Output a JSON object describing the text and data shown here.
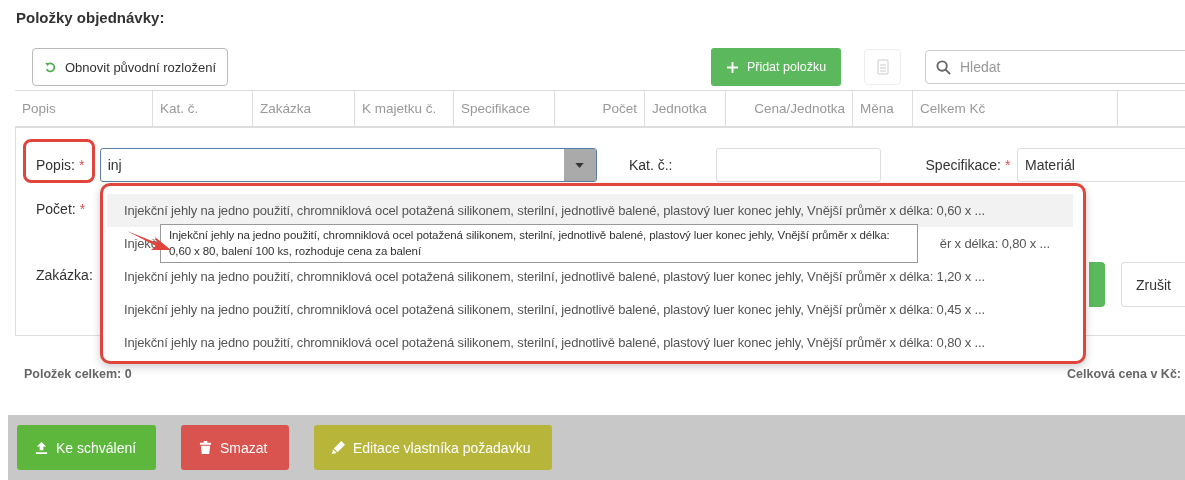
{
  "title": "Položky objednávky:",
  "toolbar": {
    "reset_button": "Obnovit původní rozložení",
    "add_button": "Přidat položku",
    "search": {
      "placeholder": "Hledat"
    }
  },
  "table": {
    "columns": [
      "Popis",
      "Kat. č.",
      "Zakázka",
      "K majetku č.",
      "Specifikace",
      "Počet",
      "Jednotka",
      "Cena/Jednotka",
      "Měna",
      "Celkem Kč"
    ]
  },
  "form": {
    "popis": {
      "label": "Popis:",
      "mark": "*",
      "value": "inj"
    },
    "kat": {
      "label": "Kat. č.:"
    },
    "specifikace": {
      "label": "Specifikace:",
      "mark": "*",
      "value": "Materiál"
    },
    "pocet": {
      "label": "Počet:",
      "mark": "*"
    },
    "zakazka": {
      "label": "Zakázka:"
    },
    "cancel_button": "Zrušit"
  },
  "dropdown": {
    "options": [
      {
        "text": "Injekční jehly na jedno použití, chromniklová ocel potažená silikonem, sterilní, jednotlivě balené, plastový luer konec jehly, Vnější průměr x délka: 0,60 x ...",
        "selected": true
      },
      {
        "text_start": "Injekč",
        "text_end": "ěr x délka: 0,80 x ...",
        "selected": false
      },
      {
        "text": "Injekční jehly na jedno použití, chromniklová ocel potažená silikonem, sterilní, jednotlivě balené, plastový luer konec jehly, Vnější průměr x délka: 1,20 x ...",
        "selected": false
      },
      {
        "text": "Injekční jehly na jedno použití, chromniklová ocel potažená silikonem, sterilní, jednotlivě balené, plastový luer konec jehly, Vnější průměr x délka: 0,45 x ...",
        "selected": false
      },
      {
        "text": "Injekční jehly na jedno použití, chromniklová ocel potažená silikonem, sterilní, jednotlivě balené, plastový luer konec jehly, Vnější průměr x délka: 0,80 x ...",
        "selected": false
      }
    ],
    "tooltip": "Injekční jehly na jedno použití, chromniklová ocel potažená silikonem, sterilní, jednotlivě balené, plastový luer konec jehly, Vnější průměr x délka: 0,60 x 80, balení 100 ks, rozhoduje cena za balení"
  },
  "summary": {
    "count": "Položek celkem: 0",
    "total": "Celková cena v Kč:"
  },
  "actions": [
    {
      "label": "Ke schválení",
      "kind": "upload",
      "color": "#5cb73c"
    },
    {
      "label": "Smazat",
      "kind": "delete",
      "color": "#d9534f"
    },
    {
      "label": "Editace vlastníka požadavku",
      "kind": "edit",
      "color": "#b8b53b"
    }
  ]
}
